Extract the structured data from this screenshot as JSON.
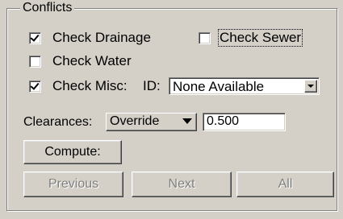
{
  "group": {
    "title": "Conflicts"
  },
  "checks": {
    "drainage": {
      "label": "Check Drainage",
      "checked": true
    },
    "sewer": {
      "label": "Check Sewer",
      "checked": false
    },
    "water": {
      "label": "Check Water",
      "checked": false
    },
    "misc": {
      "label": "Check Misc:",
      "checked": true
    }
  },
  "id_field": {
    "label": "ID:",
    "value": "None Available"
  },
  "clearances": {
    "label": "Clearances:",
    "mode": "Override",
    "value": "0.500"
  },
  "buttons": {
    "compute": "Compute:",
    "previous": "Previous",
    "next": "Next",
    "all": "All"
  }
}
